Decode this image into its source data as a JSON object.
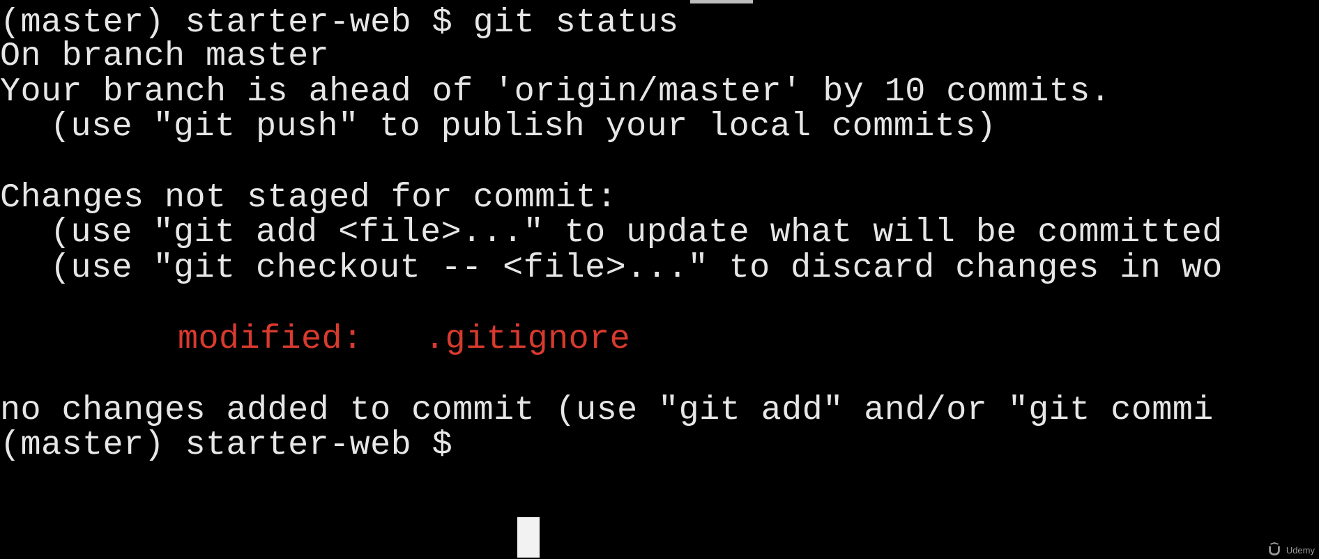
{
  "terminal": {
    "lines": [
      "(master) starter-web $ git status",
      "On branch master",
      "Your branch is ahead of 'origin/master' by 10 commits.",
      "(use \"git push\" to publish your local commits)",
      "Changes not staged for commit:",
      "(use \"git add <file>...\" to update what will be committed",
      "(use \"git checkout -- <file>...\" to discard changes in wo",
      "modified:   .gitignore",
      "no changes added to commit (use \"git add\" and/or \"git commi",
      "(master) starter-web $"
    ],
    "colors": {
      "background": "#000000",
      "text": "#e6e6e6",
      "modified": "#d83a2e"
    }
  },
  "watermark": {
    "text": "Udemy",
    "icon": "udemy-logo-icon"
  }
}
